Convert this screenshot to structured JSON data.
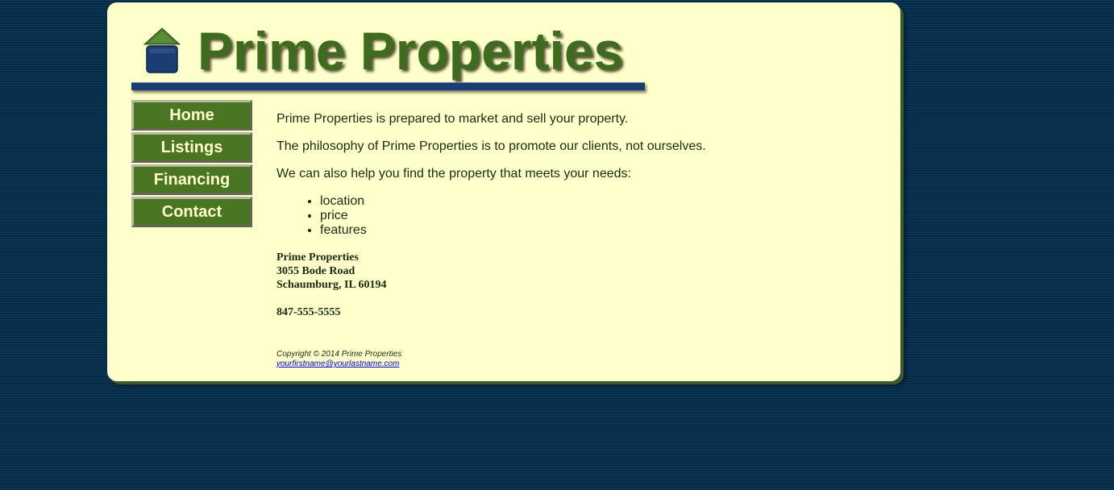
{
  "header": {
    "title": "Prime Properties",
    "logo_icon": "house-icon"
  },
  "nav": {
    "items": [
      {
        "label": "Home"
      },
      {
        "label": "Listings"
      },
      {
        "label": "Financing"
      },
      {
        "label": "Contact"
      }
    ]
  },
  "main": {
    "paragraphs": [
      "Prime Properties is prepared to market and sell your property.",
      "The philosophy of Prime Properties is to promote our clients, not ourselves.",
      "We can also help you find the property that meets your needs:"
    ],
    "needs": [
      "location",
      "price",
      "features"
    ],
    "address": {
      "name": "Prime Properties",
      "street": "3055 Bode Road",
      "city": "Schaumburg, IL 60194"
    },
    "phone": "847-555-5555"
  },
  "footer": {
    "copyright": "Copyright © 2014 Prime Properties",
    "email": "yourfirstname@yourlastname.com"
  },
  "colors": {
    "page_background": "#0a3352",
    "panel_background": "#ffffcc",
    "title_green": "#3f6b1e",
    "nav_green": "#4a7523",
    "rule_blue": "#1c3d72",
    "link_blue": "#0000cc"
  }
}
